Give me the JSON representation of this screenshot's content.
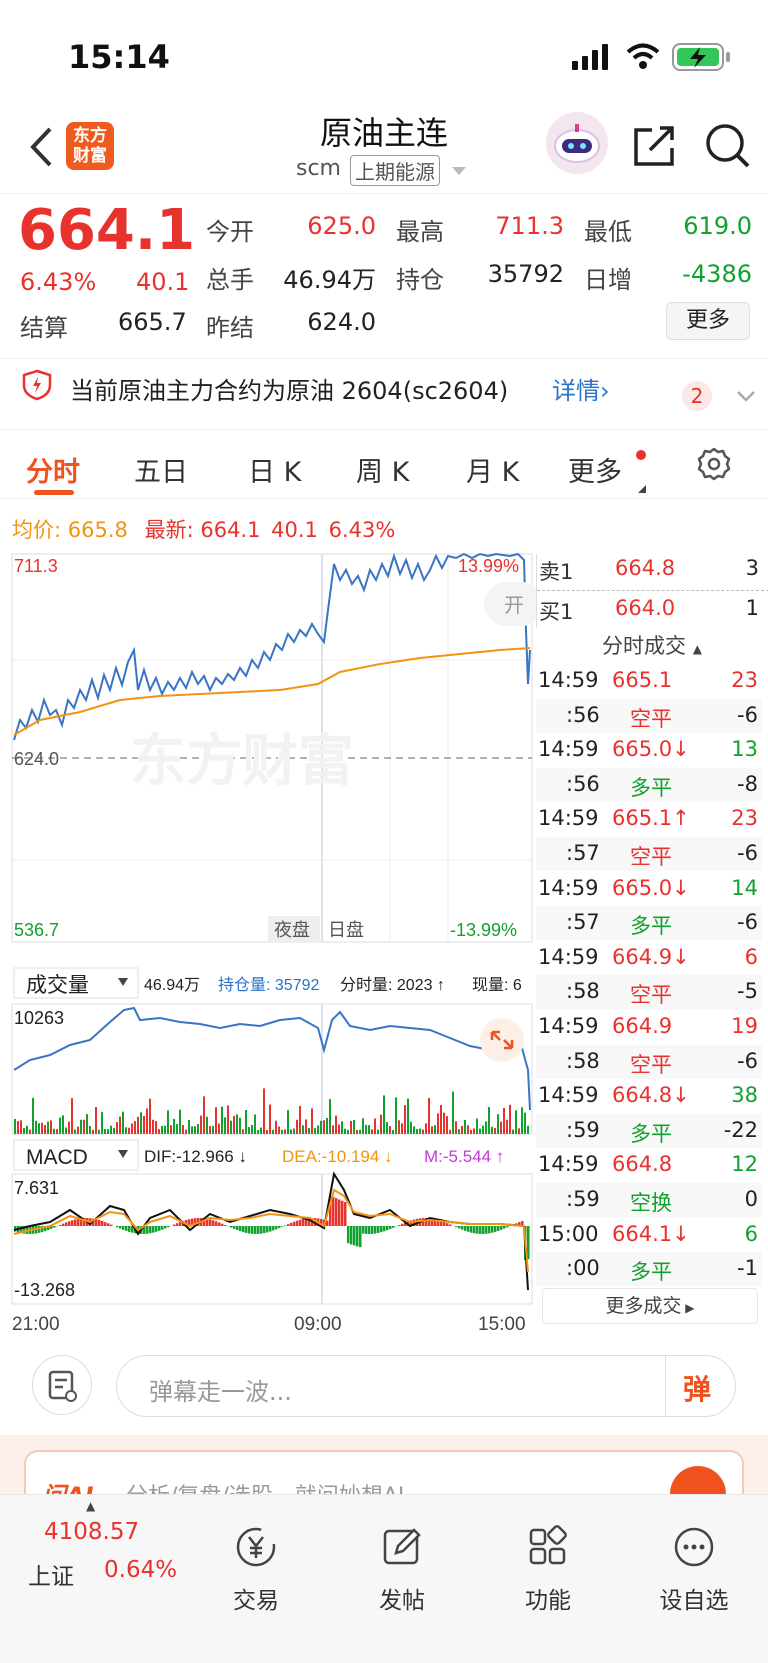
{
  "status_bar": {
    "time": "15:14"
  },
  "header": {
    "title": "原油主连",
    "code": "scm",
    "exchange": "上期能源",
    "logo_line1": "东方",
    "logo_line2": "财富"
  },
  "quote": {
    "price": "664.1",
    "change_pct": "6.43%",
    "change": "40.1",
    "settle_label": "结算",
    "settle": "665.7",
    "stats": [
      {
        "label": "今开",
        "value": "625.0"
      },
      {
        "label": "最高",
        "value": "711.3"
      },
      {
        "label": "最低",
        "value": "619.0"
      },
      {
        "label": "总手",
        "value": "46.94万"
      },
      {
        "label": "持仓",
        "value": "35792"
      },
      {
        "label": "日增",
        "value": "-4386"
      },
      {
        "label": "昨结",
        "value": "624.0"
      }
    ],
    "more_button": "更多"
  },
  "notice": {
    "text": "当前原油主力合约为原油 2604(sc2604)",
    "link": "详情",
    "badge": "2"
  },
  "tabs": [
    "分时",
    "五日",
    "日 K",
    "周 K",
    "月 K",
    "更多"
  ],
  "summary": {
    "avg_label": "均价:",
    "avg": "665.8",
    "latest_label": "最新:",
    "latest": "664.1",
    "chg": "40.1",
    "pct": "6.43%"
  },
  "price_chart": {
    "y_top": "711.3",
    "y_mid": "624.0",
    "y_bottom": "536.7",
    "pct_top": "13.99%",
    "pct_bottom": "-13.99%",
    "night_label": "夜盘",
    "day_label": "日盘",
    "open_label": "开",
    "watermark": "东方财富"
  },
  "volume_bar": {
    "selector": "成交量",
    "total": "46.94万",
    "oi_label": "持仓量: 35792",
    "min_vol": "分时量: 2023 ↑",
    "now_vol": "现量: 6",
    "y_top": "10263"
  },
  "macd_bar": {
    "selector": "MACD",
    "dif": "DIF:-12.966 ↓",
    "dea": "DEA:-10.194 ↓",
    "m": "M:-5.544 ↑",
    "y_top": "7.631",
    "y_bottom": "-13.268"
  },
  "x_axis": [
    "21:00",
    "09:00",
    "15:00"
  ],
  "order_book": [
    {
      "side": "卖1",
      "price": "664.8",
      "qty": "3"
    },
    {
      "side": "买1",
      "price": "664.0",
      "qty": "1"
    }
  ],
  "trades_title": "分时成交",
  "trades": [
    {
      "t": "14:59",
      "p": "665.1",
      "pc": "red",
      "q": "23",
      "qc": "red"
    },
    {
      "t": ":56",
      "p": "空平",
      "pc": "red",
      "q": "-6",
      "qc": "dark"
    },
    {
      "t": "14:59",
      "p": "665.0↓",
      "pc": "red",
      "q": "13",
      "qc": "green"
    },
    {
      "t": ":56",
      "p": "多平",
      "pc": "green",
      "q": "-8",
      "qc": "dark"
    },
    {
      "t": "14:59",
      "p": "665.1↑",
      "pc": "red",
      "q": "23",
      "qc": "red"
    },
    {
      "t": ":57",
      "p": "空平",
      "pc": "red",
      "q": "-6",
      "qc": "dark"
    },
    {
      "t": "14:59",
      "p": "665.0↓",
      "pc": "red",
      "q": "14",
      "qc": "green"
    },
    {
      "t": ":57",
      "p": "多平",
      "pc": "green",
      "q": "-6",
      "qc": "dark"
    },
    {
      "t": "14:59",
      "p": "664.9↓",
      "pc": "red",
      "q": "6",
      "qc": "red"
    },
    {
      "t": ":58",
      "p": "空平",
      "pc": "red",
      "q": "-5",
      "qc": "dark"
    },
    {
      "t": "14:59",
      "p": "664.9",
      "pc": "red",
      "q": "19",
      "qc": "red"
    },
    {
      "t": ":58",
      "p": "空平",
      "pc": "red",
      "q": "-6",
      "qc": "dark"
    },
    {
      "t": "14:59",
      "p": "664.8↓",
      "pc": "red",
      "q": "38",
      "qc": "green"
    },
    {
      "t": ":59",
      "p": "多平",
      "pc": "green",
      "q": "-22",
      "qc": "dark"
    },
    {
      "t": "14:59",
      "p": "664.8",
      "pc": "red",
      "q": "12",
      "qc": "green"
    },
    {
      "t": ":59",
      "p": "空换",
      "pc": "green",
      "q": "0",
      "qc": "dark"
    },
    {
      "t": "15:00",
      "p": "664.1↓",
      "pc": "red",
      "q": "6",
      "qc": "green"
    },
    {
      "t": ":00",
      "p": "多平",
      "pc": "green",
      "q": "-1",
      "qc": "dark"
    }
  ],
  "more_trades": "更多成交",
  "comment_placeholder": "弹幕走一波...",
  "danmu_button": "弹",
  "ai_banner": "分析/复盘/选股，就问妙想AI",
  "bottom_nav": {
    "index_value": "4108.57",
    "index_name": "上证",
    "index_pct": "0.64%",
    "items": [
      "交易",
      "发帖",
      "功能",
      "设自选"
    ]
  }
}
